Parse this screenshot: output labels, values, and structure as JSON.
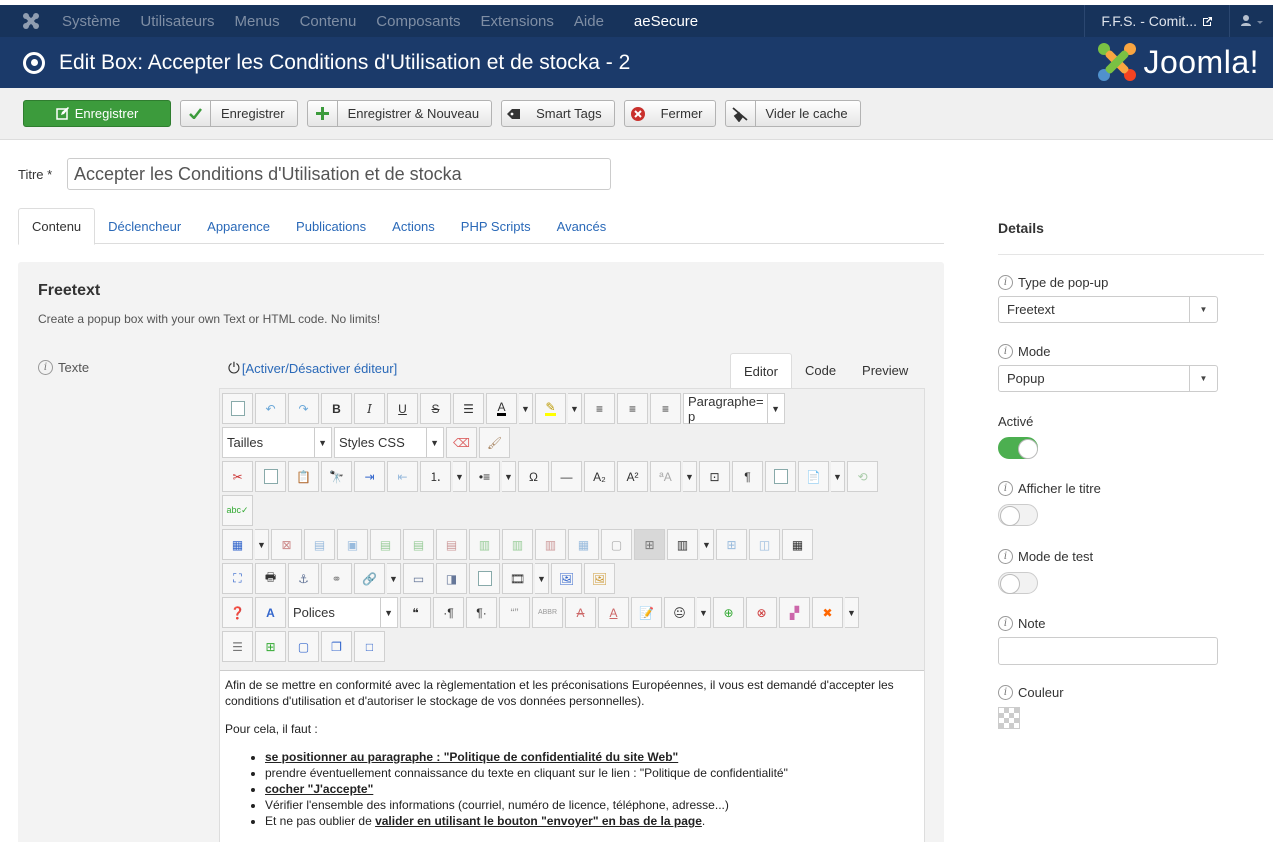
{
  "topnav": {
    "menu": [
      "Système",
      "Utilisateurs",
      "Menus",
      "Contenu",
      "Composants",
      "Extensions",
      "Aide"
    ],
    "extra": "aeSecure",
    "site": "F.F.S. - Comit..."
  },
  "header": {
    "title": "Edit Box: Accepter les Conditions d'Utilisation et de stocka - 2",
    "brand": "Joomla!"
  },
  "toolbar": {
    "save_primary": "Enregistrer",
    "save": "Enregistrer",
    "save_new": "Enregistrer & Nouveau",
    "smart_tags": "Smart Tags",
    "close": "Fermer",
    "clear_cache": "Vider le cache"
  },
  "title": {
    "label": "Titre *",
    "value": "Accepter les Conditions d'Utilisation et de stocka"
  },
  "tabs": [
    "Contenu",
    "Déclencheur",
    "Apparence",
    "Publications",
    "Actions",
    "PHP Scripts",
    "Avancés"
  ],
  "panel": {
    "heading": "Freetext",
    "description": "Create a popup box with your own Text or HTML code. No limits!",
    "text_label": "Texte",
    "toggle_editor": "[Activer/Désactiver éditeur]",
    "editor_tabs": [
      "Editor",
      "Code",
      "Preview"
    ],
    "combos": {
      "paragraph": "Paragraphe= p",
      "sizes": "Tailles",
      "styles": "Styles CSS",
      "fonts": "Polices"
    }
  },
  "content": {
    "p1": "Afin de se mettre en conformité avec la règlementation et les préconisations Européennes, il vous est demandé d'accepter les conditions d'utilisation et d'autoriser le stockage de vos données personnelles).",
    "p2": "Pour cela, il faut :",
    "li1": "se positionner au paragraphe : \"Politique de confidentialité du site Web\"",
    "li2": "prendre éventuellement connaissance du texte en cliquant sur le lien : \"Politique de confidentialité\"",
    "li3": "cocher \"J'accepte\"",
    "li4": "Vérifier l'ensemble des informations (courriel, numéro de licence, téléphone, adresse...)",
    "li5_a": "Et ne pas oublier de ",
    "li5_b": "valider en utilisant le bouton \"envoyer\" en bas de la page",
    "li5_c": "."
  },
  "details": {
    "heading": "Details",
    "popup_type_label": "Type de pop-up",
    "popup_type_value": "Freetext",
    "mode_label": "Mode",
    "mode_value": "Popup",
    "active_label": "Activé",
    "show_title_label": "Afficher le titre",
    "test_mode_label": "Mode de test",
    "note_label": "Note",
    "color_label": "Couleur"
  },
  "colors": {
    "nav": "#17335b",
    "header": "#1b3a6a",
    "primary": "#3c9b3c",
    "link": "#2a69b8"
  }
}
